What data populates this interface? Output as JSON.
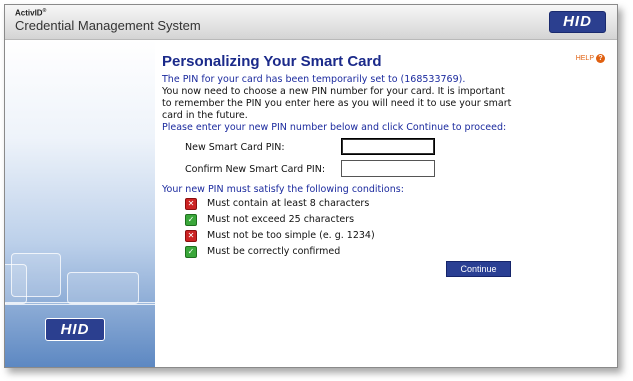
{
  "header": {
    "brand": "ActivID",
    "brand_mark": "®",
    "app_title": "Credential Management System",
    "logo_text": "HID"
  },
  "sidebar": {
    "logo_text": "HID"
  },
  "main": {
    "title": "Personalizing Your Smart Card",
    "help_label": "HELP",
    "help_icon": "?",
    "temp_pin_msg": "The PIN for your card has been temporarily set to (168533769).",
    "instructions": [
      "You now need to choose a new PIN number for your card. It is important",
      "to remember the PIN you enter here as you will need it to use your smart",
      "card in the future."
    ],
    "prompt": "Please enter your new PIN number below and click Continue to proceed:",
    "fields": {
      "new_pin_label": "New Smart Card PIN:",
      "new_pin_value": "",
      "confirm_pin_label": "Confirm New Smart Card PIN:",
      "confirm_pin_value": ""
    },
    "conditions_header": "Your new PIN must satisfy the following conditions:",
    "conditions": [
      {
        "text": "Must contain at least 8 characters",
        "status": "fail",
        "glyph": "✕"
      },
      {
        "text": "Must not exceed 25 characters",
        "status": "pass",
        "glyph": "✓"
      },
      {
        "text": "Must not be too simple (e. g. 1234)",
        "status": "fail",
        "glyph": "✕"
      },
      {
        "text": "Must be correctly confirmed",
        "status": "pass",
        "glyph": "✓"
      }
    ],
    "continue_label": "Continue"
  },
  "colors": {
    "brand_blue": "#2b3f8f",
    "title_blue": "#1b2a8a",
    "fail_red": "#cc2222",
    "pass_green": "#3aa73a",
    "help_orange": "#e06010"
  }
}
